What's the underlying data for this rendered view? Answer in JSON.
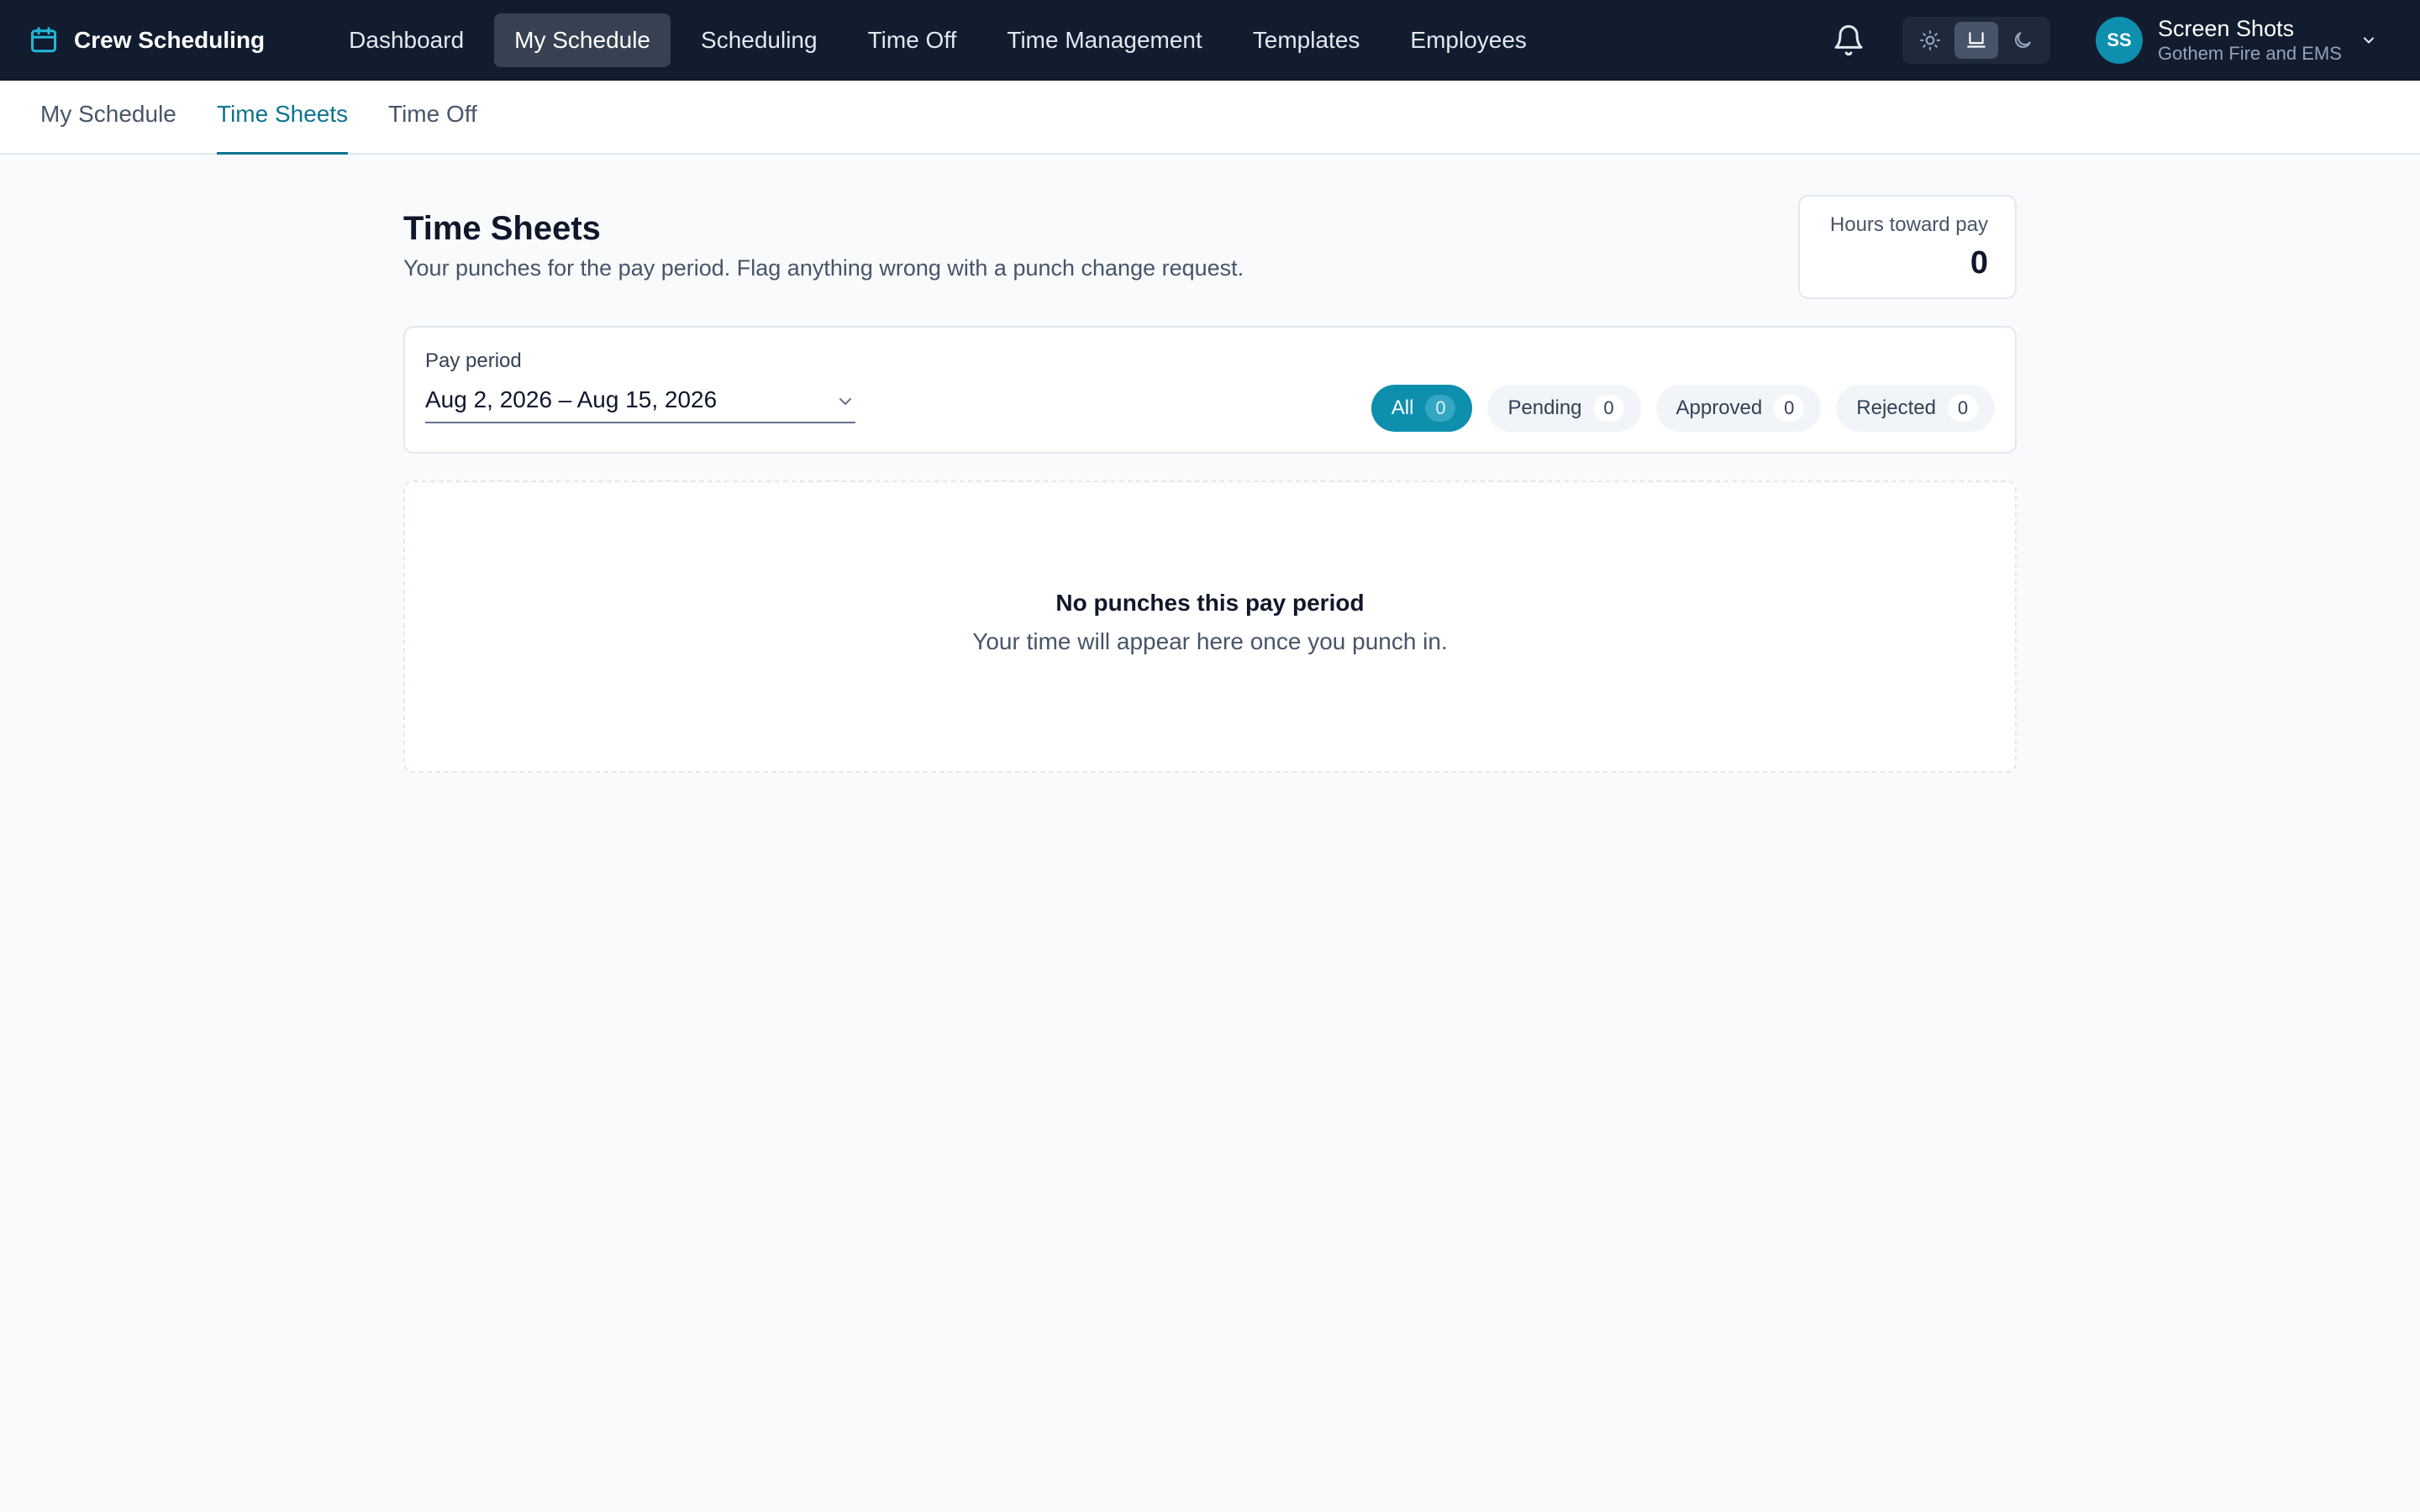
{
  "app": {
    "name": "Crew Scheduling"
  },
  "nav": {
    "items": [
      {
        "label": "Dashboard"
      },
      {
        "label": "My Schedule",
        "active": true
      },
      {
        "label": "Scheduling"
      },
      {
        "label": "Time Off"
      },
      {
        "label": "Time Management"
      },
      {
        "label": "Templates"
      },
      {
        "label": "Employees"
      }
    ]
  },
  "header": {
    "icons": [
      "bell-icon",
      "sun-icon",
      "monitor-icon",
      "moon-icon",
      "chevron-down-icon"
    ],
    "theme_selected": "system"
  },
  "user": {
    "initials": "SS",
    "name": "Screen Shots",
    "org": "Gothem Fire and EMS"
  },
  "subnav": {
    "tabs": [
      {
        "label": "My Schedule"
      },
      {
        "label": "Time Sheets",
        "active": true
      },
      {
        "label": "Time Off"
      }
    ]
  },
  "page": {
    "title": "Time Sheets",
    "subtitle": "Your punches for the pay period. Flag anything wrong with a punch change request."
  },
  "hours": {
    "label": "Hours toward pay",
    "value": "0"
  },
  "filters": {
    "period_label": "Pay period",
    "period_value": "Aug 2, 2026 – Aug 15, 2026",
    "chips": [
      {
        "label": "All",
        "count": "0",
        "active": true
      },
      {
        "label": "Pending",
        "count": "0"
      },
      {
        "label": "Approved",
        "count": "0"
      },
      {
        "label": "Rejected",
        "count": "0"
      }
    ]
  },
  "empty": {
    "title": "No punches this pay period",
    "text": "Your time will appear here once you punch in."
  },
  "colors": {
    "topbar": "#111c2e",
    "accent": "#0e8fad",
    "active_tab": "#0e7490",
    "background": "#f8fafc"
  }
}
